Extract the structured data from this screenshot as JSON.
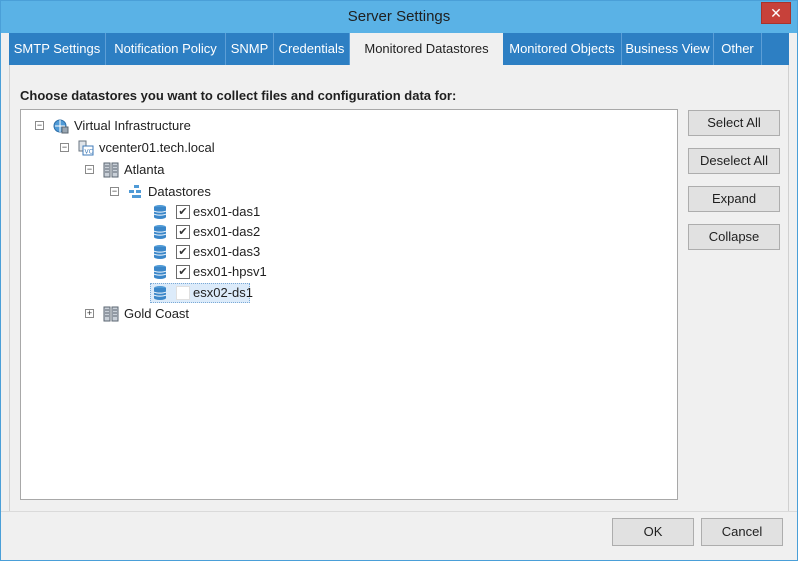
{
  "window": {
    "title": "Server Settings",
    "close_label": "✕"
  },
  "tabs": [
    {
      "label": "SMTP Settings"
    },
    {
      "label": "Notification Policy"
    },
    {
      "label": "SNMP"
    },
    {
      "label": "Credentials"
    },
    {
      "label": "Monitored Datastores"
    },
    {
      "label": "Monitored Objects"
    },
    {
      "label": "Business View"
    },
    {
      "label": "Other"
    }
  ],
  "main": {
    "instruction": "Choose datastores you want to collect files and configuration data for:"
  },
  "tree": {
    "root": {
      "label": "Virtual Infrastructure",
      "icon": "globe-icon",
      "expander": "−"
    },
    "vcenter": {
      "label": "vcenter01.tech.local",
      "icon": "vcenter-icon",
      "expander": "−"
    },
    "atlanta": {
      "label": "Atlanta",
      "icon": "datacenter-icon",
      "expander": "−"
    },
    "datastores": {
      "label": "Datastores",
      "icon": "datastores-folder-icon",
      "expander": "−"
    },
    "items": [
      {
        "label": "esx01-das1",
        "checked": true,
        "check_glyph": "✔",
        "icon": "datastore-icon"
      },
      {
        "label": "esx01-das2",
        "checked": true,
        "check_glyph": "✔",
        "icon": "datastore-icon"
      },
      {
        "label": "esx01-das3",
        "checked": true,
        "check_glyph": "✔",
        "icon": "datastore-icon"
      },
      {
        "label": "esx01-hpsv1",
        "checked": true,
        "check_glyph": "✔",
        "icon": "datastore-icon"
      },
      {
        "label": "esx02-ds1",
        "checked": false,
        "check_glyph": "",
        "icon": "datastore-icon"
      }
    ],
    "gold_coast": {
      "label": "Gold Coast",
      "icon": "datacenter-icon",
      "expander": "+"
    }
  },
  "buttons": {
    "select_all": "Select All",
    "deselect_all": "Deselect All",
    "expand": "Expand",
    "collapse": "Collapse",
    "ok": "OK",
    "cancel": "Cancel"
  },
  "colors": {
    "titlebar": "#5ab2e6",
    "tabstrip": "#2d7fc3",
    "close": "#c7413a"
  }
}
